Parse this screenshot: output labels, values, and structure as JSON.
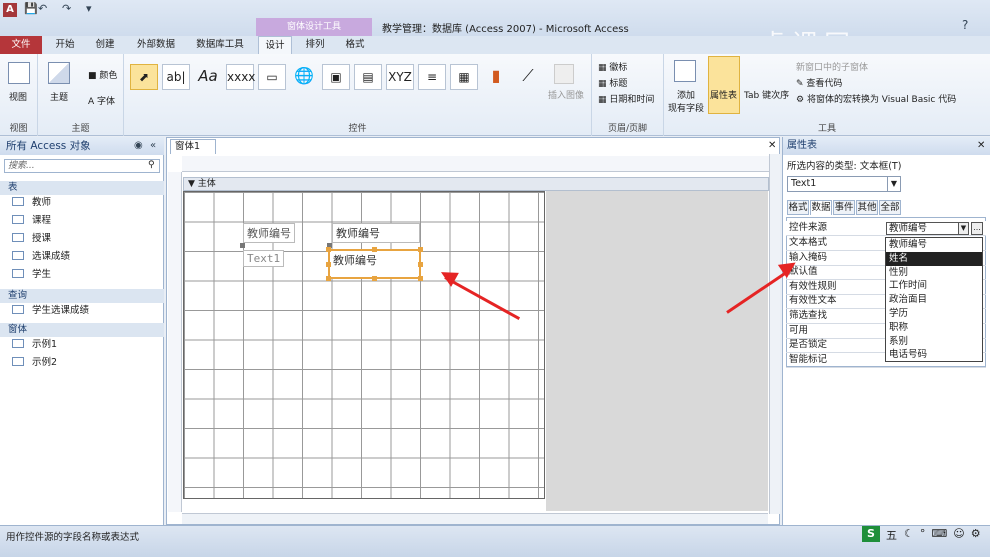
{
  "window": {
    "title": "教学管理：数据库 (Access 2007)  -  Microsoft Access",
    "context_group": "窗体设计工具",
    "app_icon": "A"
  },
  "ribbon_tabs": [
    "文件",
    "开始",
    "创建",
    "外部数据",
    "数据库工具",
    "设计",
    "排列",
    "格式"
  ],
  "ribbon": {
    "view": {
      "label": "视图",
      "group": "视图"
    },
    "theme": {
      "theme_label": "主题",
      "color_label": "颜色",
      "font_label": "字体",
      "group": "主题"
    },
    "controls": {
      "label_text": "Aa",
      "textbox_text": "ab|",
      "group": "控件",
      "insert_image": "插入图像"
    },
    "header_footer": {
      "logo": "徽标",
      "title": "标题",
      "datetime": "日期和时间",
      "group": "页眉/页脚"
    },
    "tools": {
      "add_fields": "添加\n现有字段",
      "property_sheet": "属性表",
      "tab_order": "Tab 键次序",
      "new_window": "新窗口中的子窗体",
      "view_code": "查看代码",
      "convert_macros": "将窗体的宏转换为 Visual Basic 代码",
      "group": "工具"
    }
  },
  "nav": {
    "title": "所有 Access 对象",
    "search_placeholder": "搜索...",
    "sections": [
      {
        "title": "表",
        "items": [
          "教师",
          "课程",
          "授课",
          "选课成绩",
          "学生"
        ]
      },
      {
        "title": "查询",
        "items": [
          "学生选课成绩"
        ]
      },
      {
        "title": "窗体",
        "items": [
          "示例1",
          "示例2"
        ]
      }
    ]
  },
  "document": {
    "tab": "窗体1",
    "section": "主体"
  },
  "form_controls": {
    "label1": "教师编号",
    "textbox1": "教师编号",
    "label2": "Text1",
    "textbox2": "教师编号"
  },
  "properties": {
    "title": "属性表",
    "selection_type": "所选内容的类型: 文本框(T)",
    "selected_control": "Text1",
    "tabs": [
      "格式",
      "数据",
      "事件",
      "其他",
      "全部"
    ],
    "rows": [
      "控件来源",
      "文本格式",
      "输入掩码",
      "默认值",
      "有效性规则",
      "有效性文本",
      "筛选查找",
      "可用",
      "是否锁定",
      "智能标记"
    ],
    "control_source_value": "教师编号",
    "dropdown": [
      "教师编号",
      "姓名",
      "性别",
      "工作时间",
      "政治面目",
      "学历",
      "职称",
      "系别",
      "电话号码"
    ],
    "dropdown_highlight": "姓名"
  },
  "status": {
    "text": "用作控件源的字段名称或表达式",
    "ime": "五"
  },
  "colors": {
    "accent": "#b5363a",
    "context": "#c8a9de",
    "arrow": "#e52424",
    "selection": "#e8a440"
  }
}
